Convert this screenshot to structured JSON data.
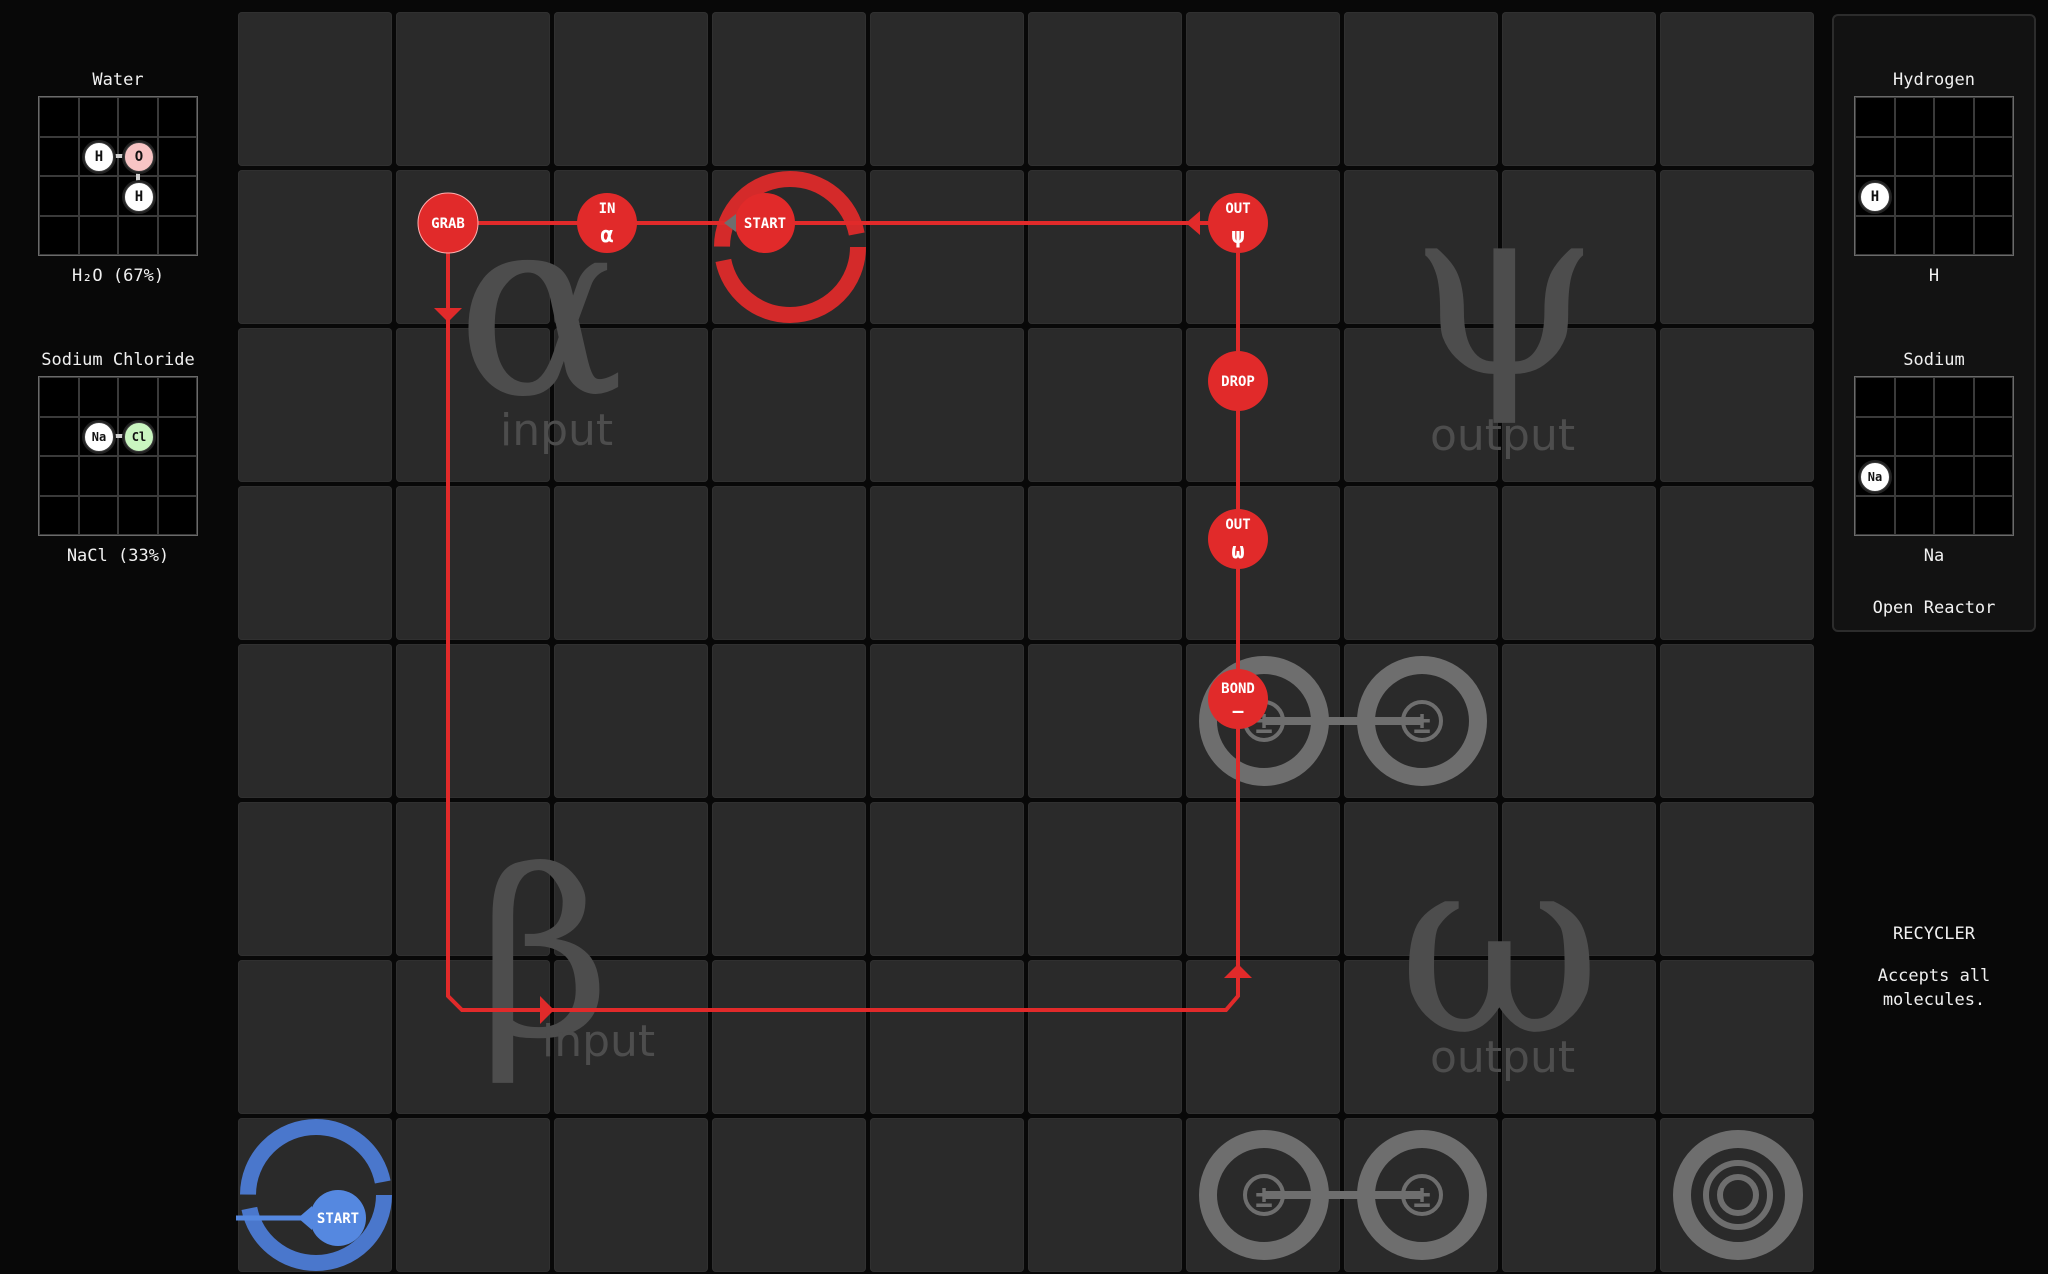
{
  "inputs": [
    {
      "title": "Water",
      "label": "H₂O (67%)",
      "atoms": [
        {
          "symbol": "H",
          "color": "#ffffff"
        },
        {
          "symbol": "O",
          "color": "#f7c4c4"
        },
        {
          "symbol": "H",
          "color": "#ffffff"
        }
      ]
    },
    {
      "title": "Sodium Chloride",
      "label": "NaCl (33%)",
      "atoms": [
        {
          "symbol": "Na",
          "color": "#ffffff"
        },
        {
          "symbol": "Cl",
          "color": "#c9f5c0"
        }
      ]
    }
  ],
  "outputs": [
    {
      "title": "Hydrogen",
      "label": "H",
      "atom": "H"
    },
    {
      "title": "Sodium",
      "label": "Na",
      "atom": "Na"
    }
  ],
  "reactor": {
    "type": "Open Reactor"
  },
  "recycler": {
    "title": "RECYCLER",
    "desc_line1": "Accepts all",
    "desc_line2": "molecules."
  },
  "zones": {
    "alpha": {
      "glyph": "α",
      "word": "input"
    },
    "beta": {
      "glyph": "β",
      "word": "input"
    },
    "psi": {
      "glyph": "ψ",
      "word": "output"
    },
    "omega": {
      "glyph": "ω",
      "word": "output"
    }
  },
  "instructions": {
    "red": [
      {
        "label": "GRAB",
        "sub": ""
      },
      {
        "label": "IN",
        "sub": "α"
      },
      {
        "label": "START",
        "sub": ""
      },
      {
        "label": "OUT",
        "sub": "ψ"
      },
      {
        "label": "DROP",
        "sub": ""
      },
      {
        "label": "OUT",
        "sub": "ω"
      },
      {
        "label": "BOND",
        "sub": "—"
      }
    ],
    "blue": [
      {
        "label": "START",
        "sub": ""
      }
    ]
  },
  "bonder_symbol": "±",
  "colors": {
    "red": "#e12a2a",
    "blue": "#5588e0",
    "board_cell": "#2a2a2a",
    "zone_text": "#4d4d4d",
    "machine_gray": "#6e6e6e"
  }
}
